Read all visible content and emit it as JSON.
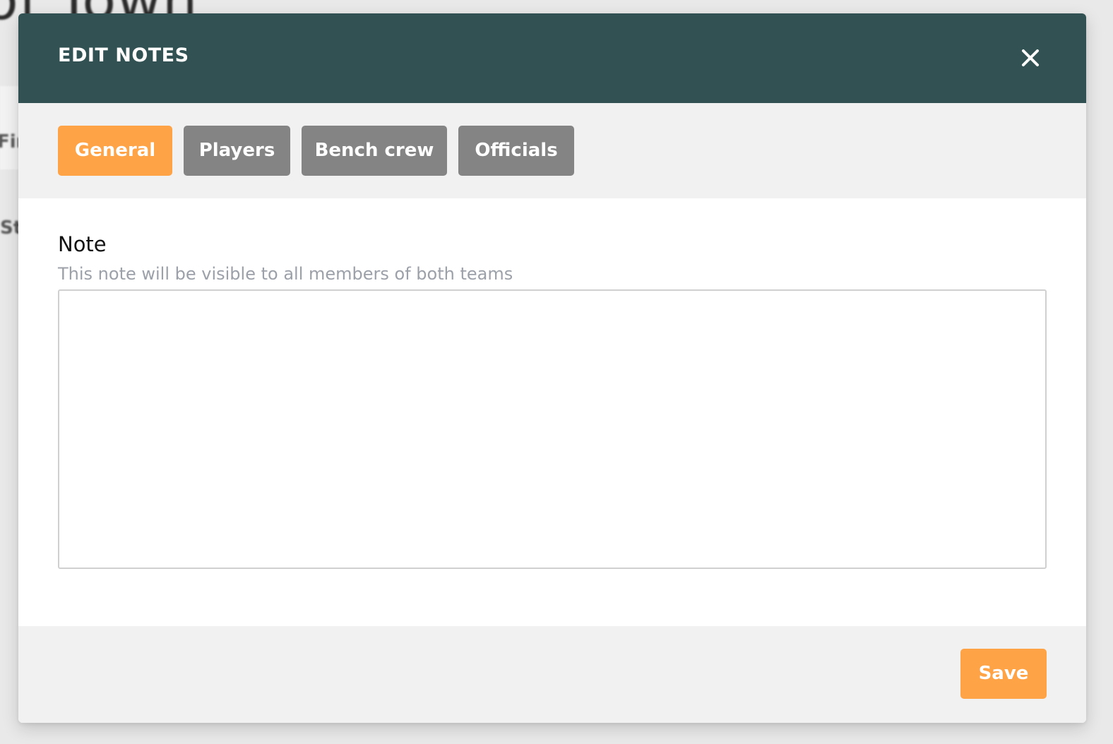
{
  "background": {
    "title_fragment": "of Town",
    "card_fragment": "Fir",
    "side_fragment": "St"
  },
  "modal": {
    "title": "EDIT NOTES",
    "close_icon": "close-icon",
    "header_color": "#325152"
  },
  "tabs": [
    {
      "label": "General",
      "active": true
    },
    {
      "label": "Players",
      "active": false
    },
    {
      "label": "Bench crew",
      "active": false
    },
    {
      "label": "Officials",
      "active": false
    }
  ],
  "note": {
    "label": "Note",
    "help_text": "This note will be visible to all members of both teams",
    "value": ""
  },
  "footer": {
    "save_label": "Save"
  },
  "colors": {
    "accent": "#ffa347",
    "tab_inactive": "#848484",
    "panel_gray": "#f1f1f1"
  }
}
